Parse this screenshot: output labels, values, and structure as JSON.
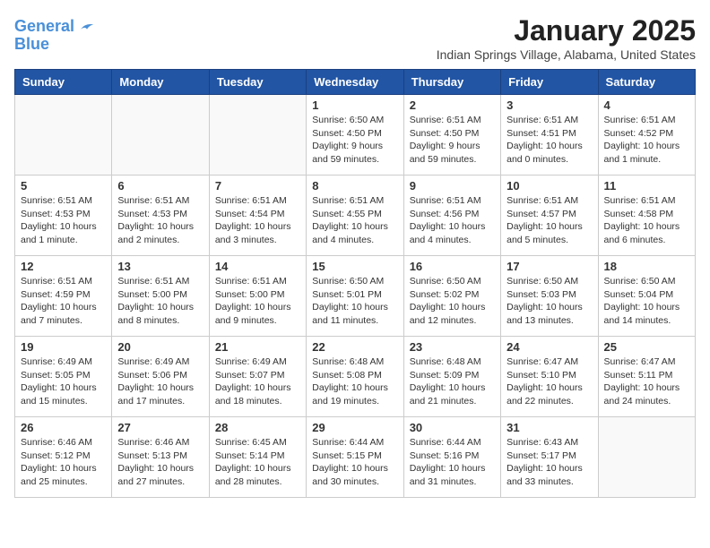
{
  "logo": {
    "line1": "General",
    "line2": "Blue"
  },
  "header": {
    "title": "January 2025",
    "subtitle": "Indian Springs Village, Alabama, United States"
  },
  "weekdays": [
    "Sunday",
    "Monday",
    "Tuesday",
    "Wednesday",
    "Thursday",
    "Friday",
    "Saturday"
  ],
  "weeks": [
    [
      {
        "day": "",
        "info": ""
      },
      {
        "day": "",
        "info": ""
      },
      {
        "day": "",
        "info": ""
      },
      {
        "day": "1",
        "info": "Sunrise: 6:50 AM\nSunset: 4:50 PM\nDaylight: 9 hours and 59 minutes."
      },
      {
        "day": "2",
        "info": "Sunrise: 6:51 AM\nSunset: 4:50 PM\nDaylight: 9 hours and 59 minutes."
      },
      {
        "day": "3",
        "info": "Sunrise: 6:51 AM\nSunset: 4:51 PM\nDaylight: 10 hours and 0 minutes."
      },
      {
        "day": "4",
        "info": "Sunrise: 6:51 AM\nSunset: 4:52 PM\nDaylight: 10 hours and 1 minute."
      }
    ],
    [
      {
        "day": "5",
        "info": "Sunrise: 6:51 AM\nSunset: 4:53 PM\nDaylight: 10 hours and 1 minute."
      },
      {
        "day": "6",
        "info": "Sunrise: 6:51 AM\nSunset: 4:53 PM\nDaylight: 10 hours and 2 minutes."
      },
      {
        "day": "7",
        "info": "Sunrise: 6:51 AM\nSunset: 4:54 PM\nDaylight: 10 hours and 3 minutes."
      },
      {
        "day": "8",
        "info": "Sunrise: 6:51 AM\nSunset: 4:55 PM\nDaylight: 10 hours and 4 minutes."
      },
      {
        "day": "9",
        "info": "Sunrise: 6:51 AM\nSunset: 4:56 PM\nDaylight: 10 hours and 4 minutes."
      },
      {
        "day": "10",
        "info": "Sunrise: 6:51 AM\nSunset: 4:57 PM\nDaylight: 10 hours and 5 minutes."
      },
      {
        "day": "11",
        "info": "Sunrise: 6:51 AM\nSunset: 4:58 PM\nDaylight: 10 hours and 6 minutes."
      }
    ],
    [
      {
        "day": "12",
        "info": "Sunrise: 6:51 AM\nSunset: 4:59 PM\nDaylight: 10 hours and 7 minutes."
      },
      {
        "day": "13",
        "info": "Sunrise: 6:51 AM\nSunset: 5:00 PM\nDaylight: 10 hours and 8 minutes."
      },
      {
        "day": "14",
        "info": "Sunrise: 6:51 AM\nSunset: 5:00 PM\nDaylight: 10 hours and 9 minutes."
      },
      {
        "day": "15",
        "info": "Sunrise: 6:50 AM\nSunset: 5:01 PM\nDaylight: 10 hours and 11 minutes."
      },
      {
        "day": "16",
        "info": "Sunrise: 6:50 AM\nSunset: 5:02 PM\nDaylight: 10 hours and 12 minutes."
      },
      {
        "day": "17",
        "info": "Sunrise: 6:50 AM\nSunset: 5:03 PM\nDaylight: 10 hours and 13 minutes."
      },
      {
        "day": "18",
        "info": "Sunrise: 6:50 AM\nSunset: 5:04 PM\nDaylight: 10 hours and 14 minutes."
      }
    ],
    [
      {
        "day": "19",
        "info": "Sunrise: 6:49 AM\nSunset: 5:05 PM\nDaylight: 10 hours and 15 minutes."
      },
      {
        "day": "20",
        "info": "Sunrise: 6:49 AM\nSunset: 5:06 PM\nDaylight: 10 hours and 17 minutes."
      },
      {
        "day": "21",
        "info": "Sunrise: 6:49 AM\nSunset: 5:07 PM\nDaylight: 10 hours and 18 minutes."
      },
      {
        "day": "22",
        "info": "Sunrise: 6:48 AM\nSunset: 5:08 PM\nDaylight: 10 hours and 19 minutes."
      },
      {
        "day": "23",
        "info": "Sunrise: 6:48 AM\nSunset: 5:09 PM\nDaylight: 10 hours and 21 minutes."
      },
      {
        "day": "24",
        "info": "Sunrise: 6:47 AM\nSunset: 5:10 PM\nDaylight: 10 hours and 22 minutes."
      },
      {
        "day": "25",
        "info": "Sunrise: 6:47 AM\nSunset: 5:11 PM\nDaylight: 10 hours and 24 minutes."
      }
    ],
    [
      {
        "day": "26",
        "info": "Sunrise: 6:46 AM\nSunset: 5:12 PM\nDaylight: 10 hours and 25 minutes."
      },
      {
        "day": "27",
        "info": "Sunrise: 6:46 AM\nSunset: 5:13 PM\nDaylight: 10 hours and 27 minutes."
      },
      {
        "day": "28",
        "info": "Sunrise: 6:45 AM\nSunset: 5:14 PM\nDaylight: 10 hours and 28 minutes."
      },
      {
        "day": "29",
        "info": "Sunrise: 6:44 AM\nSunset: 5:15 PM\nDaylight: 10 hours and 30 minutes."
      },
      {
        "day": "30",
        "info": "Sunrise: 6:44 AM\nSunset: 5:16 PM\nDaylight: 10 hours and 31 minutes."
      },
      {
        "day": "31",
        "info": "Sunrise: 6:43 AM\nSunset: 5:17 PM\nDaylight: 10 hours and 33 minutes."
      },
      {
        "day": "",
        "info": ""
      }
    ]
  ]
}
